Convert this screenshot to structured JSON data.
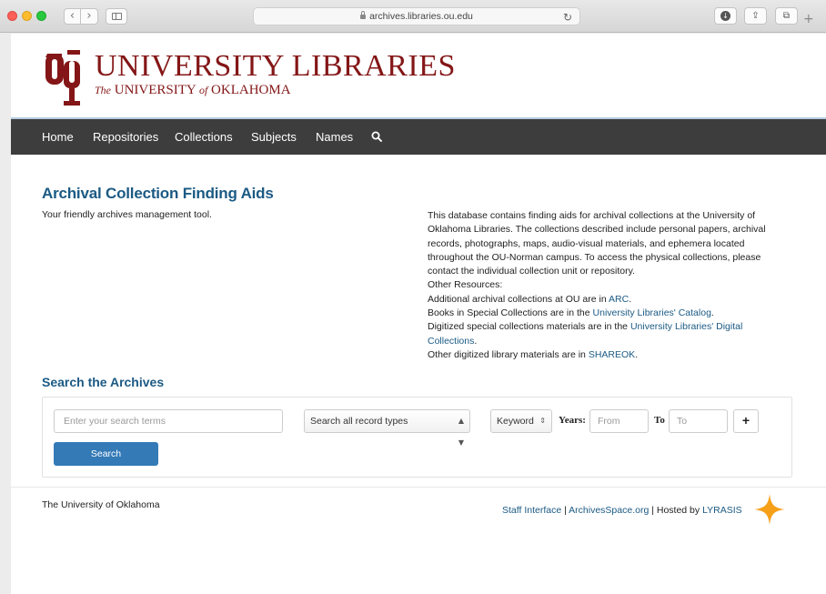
{
  "browser": {
    "url": "archives.libraries.ou.edu",
    "back_glyph": "‹",
    "forward_glyph": "›",
    "reload_glyph": "↻",
    "download_glyph": "↓",
    "share_glyph": "⇪",
    "tabs_glyph": "⧉",
    "new_tab_glyph": "+"
  },
  "header": {
    "title": "UNIVERSITY LIBRARIES",
    "subtitle_the": "The",
    "subtitle_university": " UNIVERSITY ",
    "subtitle_of": "of",
    "subtitle_state": " OKLAHOMA",
    "brand_color": "#841617"
  },
  "nav": {
    "items": [
      "Home",
      "Repositories",
      "Collections",
      "Subjects",
      "Names"
    ],
    "search_icon": "search-icon"
  },
  "main": {
    "heading": "Archival Collection Finding Aids",
    "tagline": "Your friendly archives management tool.",
    "about": {
      "p1": "This database contains finding aids for archival collections at the University of Oklahoma Libraries. The collections described include personal papers, archival records, photographs, maps, audio-visual materials, and ephemera located throughout the OU-Norman campus. To access the physical collections, please contact the individual collection unit or repository.",
      "other_resources": "Other Resources:",
      "l1_pre": "Additional archival collections at OU are in ",
      "l1_link": "ARC",
      "l1_post": ".",
      "l2_pre": "Books in Special Collections are in the ",
      "l2_link": "University Libraries' Catalog",
      "l2_post": ".",
      "l3_pre": "Digitized special collections materials are in the ",
      "l3_link": "University Libraries' Digital Collections",
      "l3_post": ".",
      "l4_pre": "Other digitized library materials are in ",
      "l4_link": "SHAREOK",
      "l4_post": "."
    }
  },
  "search": {
    "heading": "Search the Archives",
    "query_placeholder": "Enter your search terms",
    "record_type": "Search all record types",
    "field": "Keyword",
    "years_label": "Years:",
    "from_placeholder": "From",
    "to_label": "To",
    "to_placeholder": "To",
    "plus": "+",
    "button": "Search"
  },
  "footer": {
    "left": "The University of Oklahoma",
    "staff_link": "Staff Interface",
    "sep1": " | ",
    "archivesspace_link": "ArchivesSpace.org",
    "sep2": " | Hosted by ",
    "lyrasis_link": "LYRASIS"
  },
  "colors": {
    "heading_blue": "#1b5a84",
    "navbar": "#3d3d3d",
    "button_blue": "#337ab7",
    "star_orange": "#f6a01a"
  }
}
